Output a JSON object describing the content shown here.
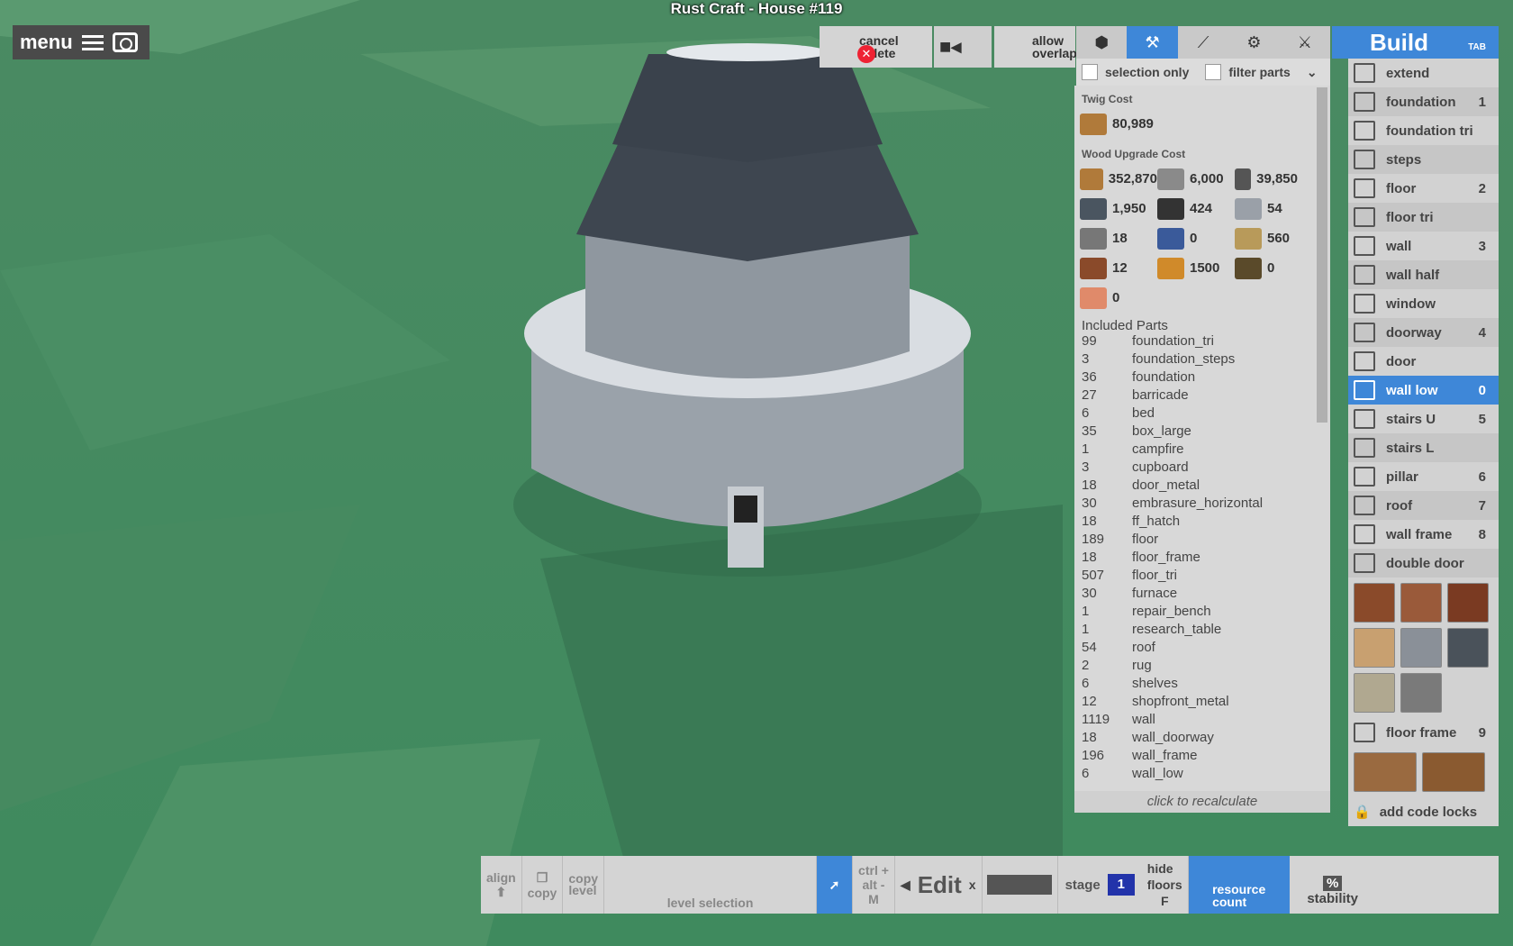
{
  "window": {
    "title": "Rust Craft - House #119"
  },
  "menu": {
    "label": "menu",
    "menu_icon": "hamburger-icon",
    "camera_icon": "camera-icon"
  },
  "top_buttons": {
    "cancel_delete": "cancel\ndelete",
    "allow_overlap": "allow\noverlap",
    "rec_icon": "video-camera-icon"
  },
  "toolbar": {
    "tools": [
      "cube-icon",
      "hammer-icon",
      "pickaxe-icon",
      "wrench-icon",
      "hatchet-icon"
    ],
    "active_index": 1,
    "selection_only": "selection only",
    "filter_parts": "filter parts"
  },
  "cost_panel": {
    "twig_header": "Twig Cost",
    "twig_value": "80,989",
    "wood_header": "Wood Upgrade Cost",
    "wood_costs": [
      {
        "value": "352,870",
        "color": "#b07a3a",
        "icon": "wood-icon"
      },
      {
        "value": "6,000",
        "color": "#8a8a8a",
        "icon": "stones-icon"
      },
      {
        "value": "39,850",
        "color": "#555555",
        "icon": "metal-fragments-icon"
      },
      {
        "value": "1,950",
        "color": "#4a5560",
        "icon": "hq-metal-icon"
      },
      {
        "value": "424",
        "color": "#333333",
        "icon": "gears-icon"
      },
      {
        "value": "54",
        "color": "#9aa0a8",
        "icon": "sheet-metal-icon"
      },
      {
        "value": "18",
        "color": "#777777",
        "icon": "rope-icon"
      },
      {
        "value": "0",
        "color": "#3a5a9a",
        "icon": "tarp-icon"
      },
      {
        "value": "560",
        "color": "#b89a5a",
        "icon": "cloth-icon"
      },
      {
        "value": "12",
        "color": "#8a4a2a",
        "icon": "barrel-icon"
      },
      {
        "value": "1500",
        "color": "#d08a2a",
        "icon": "lowgrade-fuel-icon"
      },
      {
        "value": "0",
        "color": "#5a4a2a",
        "icon": "rope-coil-icon"
      },
      {
        "value": "0",
        "color": "#e08a6a",
        "icon": "leather-icon"
      }
    ],
    "parts_header": "Included Parts",
    "parts": [
      {
        "count": "99",
        "name": "foundation_tri"
      },
      {
        "count": "3",
        "name": "foundation_steps"
      },
      {
        "count": "36",
        "name": "foundation"
      },
      {
        "count": "27",
        "name": "barricade"
      },
      {
        "count": "6",
        "name": "bed"
      },
      {
        "count": "35",
        "name": "box_large"
      },
      {
        "count": "1",
        "name": "campfire"
      },
      {
        "count": "3",
        "name": "cupboard"
      },
      {
        "count": "18",
        "name": "door_metal"
      },
      {
        "count": "30",
        "name": "embrasure_horizontal"
      },
      {
        "count": "18",
        "name": "ff_hatch"
      },
      {
        "count": "189",
        "name": "floor"
      },
      {
        "count": "18",
        "name": "floor_frame"
      },
      {
        "count": "507",
        "name": "floor_tri"
      },
      {
        "count": "30",
        "name": "furnace"
      },
      {
        "count": "1",
        "name": "repair_bench"
      },
      {
        "count": "1",
        "name": "research_table"
      },
      {
        "count": "54",
        "name": "roof"
      },
      {
        "count": "2",
        "name": "rug"
      },
      {
        "count": "6",
        "name": "shelves"
      },
      {
        "count": "12",
        "name": "shopfront_metal"
      },
      {
        "count": "1119",
        "name": "wall"
      },
      {
        "count": "18",
        "name": "wall_doorway"
      },
      {
        "count": "196",
        "name": "wall_frame"
      },
      {
        "count": "6",
        "name": "wall_low"
      }
    ],
    "recalc": "click to recalculate"
  },
  "build_panel": {
    "title": "Build",
    "tab_hint": "TAB",
    "items": [
      {
        "label": "extend",
        "key": "",
        "selected": false
      },
      {
        "label": "foundation",
        "key": "1",
        "selected": false
      },
      {
        "label": "foundation tri",
        "key": "",
        "selected": false
      },
      {
        "label": "steps",
        "key": "",
        "selected": false
      },
      {
        "label": "floor",
        "key": "2",
        "selected": false
      },
      {
        "label": "floor tri",
        "key": "",
        "selected": false
      },
      {
        "label": "wall",
        "key": "3",
        "selected": false
      },
      {
        "label": "wall half",
        "key": "",
        "selected": false
      },
      {
        "label": "window",
        "key": "",
        "selected": false
      },
      {
        "label": "doorway",
        "key": "4",
        "selected": false
      },
      {
        "label": "door",
        "key": "",
        "selected": false
      },
      {
        "label": "wall low",
        "key": "0",
        "selected": true
      },
      {
        "label": "stairs U",
        "key": "5",
        "selected": false
      },
      {
        "label": "stairs L",
        "key": "",
        "selected": false
      },
      {
        "label": "pillar",
        "key": "6",
        "selected": false
      },
      {
        "label": "roof",
        "key": "7",
        "selected": false
      },
      {
        "label": "wall frame",
        "key": "8",
        "selected": false
      },
      {
        "label": "double door",
        "key": "",
        "selected": false
      }
    ],
    "floor_frame": {
      "label": "floor frame",
      "key": "9"
    },
    "add_code_locks": "add code locks"
  },
  "bottom_bar": {
    "align": "align",
    "copy": "copy",
    "copy_level": "copy\nlevel",
    "level_selection": "level selection",
    "ctrl": "ctrl +",
    "alt": "alt -",
    "m_key": "M",
    "edit": "Edit",
    "x": "x",
    "stage_label": "stage",
    "stage_value": "1",
    "hide_floors": "hide\nfloors",
    "f_key": "F",
    "resource_count": "resource\ncount",
    "percent": "%",
    "stability": "stability"
  }
}
